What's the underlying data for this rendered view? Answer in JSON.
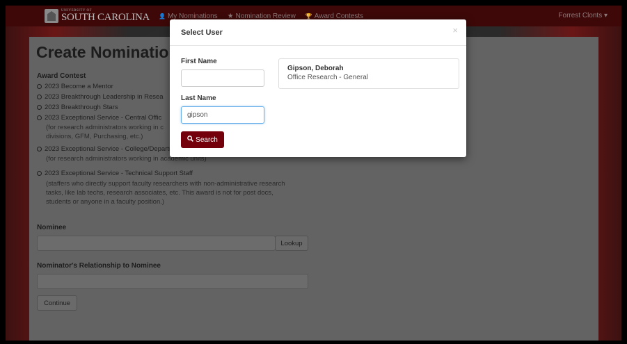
{
  "navbar": {
    "logo_small": "UNIVERSITY OF",
    "logo_big": "SOUTH CAROLINA",
    "links": [
      {
        "icon": "user-icon",
        "glyph": "👤",
        "label": "My Nominations"
      },
      {
        "icon": "star-icon",
        "glyph": "★",
        "label": "Nomination Review"
      },
      {
        "icon": "trophy-icon",
        "glyph": "🏆",
        "label": "Award Contests"
      }
    ],
    "user": "Forrest Clonts ▾"
  },
  "page": {
    "title": "Create Nominatio",
    "award_contest_label": "Award Contest",
    "options": [
      "2023 Become a Mentor",
      "2023 Breakthrough Leadership in Resea",
      "2023 Breakthrough Stars",
      "2023 Exceptional Service - Central Offic",
      "2023 Exceptional Service - College/Departmental",
      "2023 Exceptional Service - Technical Support Staff"
    ],
    "desc_central_1": "(for research administrators working in c",
    "desc_central_2": "divisions, GFM, Purchasing, etc.)",
    "desc_college": "(for research administrators working in academic units)",
    "desc_tech_1": "(staffers who directly support faculty researchers with non-administrative research",
    "desc_tech_2": "tasks, like lab techs, research associates, etc. This award is not for post docs,",
    "desc_tech_3": "students or anyone in a faculty position.)",
    "nominee_label": "Nominee",
    "lookup_label": "Lookup",
    "relationship_label": "Nominator's Relationship to Nominee",
    "continue_label": "Continue"
  },
  "modal": {
    "title": "Select User",
    "close": "×",
    "first_name_label": "First Name",
    "first_name_value": "",
    "last_name_label": "Last Name",
    "last_name_value": "gipson",
    "search_label": "Search",
    "result": {
      "name": "Gipson, Deborah",
      "dept": "Office Research - General"
    }
  }
}
